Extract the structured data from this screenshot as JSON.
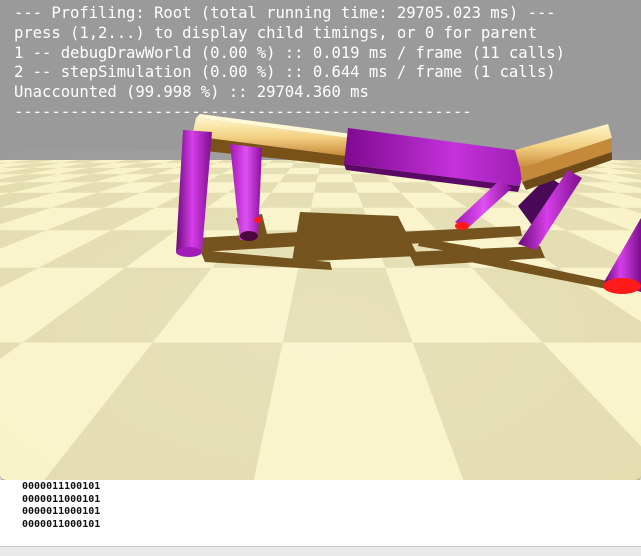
{
  "profiler": {
    "lines": [
      "--- Profiling: Root (total running time: 29705.023 ms) ---",
      "press (1,2...) to display child timings, or 0 for parent",
      "1 -- debugDrawWorld (0.00 %) :: 0.019 ms / frame (11 calls)",
      "2 -- stepSimulation (0.00 %) :: 0.644 ms / frame (1 calls)",
      "Unaccounted (99.998 %) :: 29704.360 ms",
      "-------------------------------------------------"
    ]
  },
  "console": {
    "lines": [
      "0000011100101",
      "0000011000101",
      "0000011000101",
      "0000011000101"
    ]
  },
  "colors": {
    "sky": "#9a9a9a",
    "floor_light": "#fbf6cc",
    "floor_dark": "#e3dcae",
    "shadow": "#6b4a14",
    "body_top": "#f6dc90",
    "leg_magenta": "#b81ecd",
    "foot_red": "#ff1a1a"
  }
}
